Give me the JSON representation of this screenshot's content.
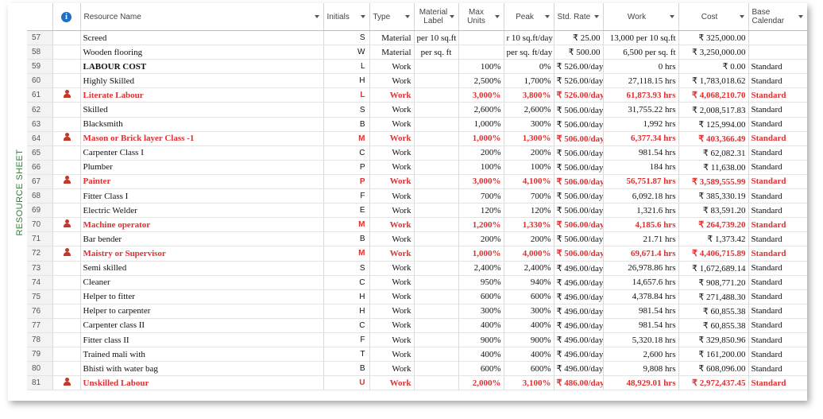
{
  "side_label": "RESOURCE SHEET",
  "columns": {
    "name": "Resource Name",
    "initials": "Initials",
    "type": "Type",
    "material_label": "Material Label",
    "max_units": "Max Units",
    "peak": "Peak",
    "std_rate": "Std. Rate",
    "work": "Work",
    "cost": "Cost",
    "base_calendar": "Base Calendar"
  },
  "rows": [
    {
      "num": "57",
      "name": "Screed",
      "initials": "S",
      "type": "Material",
      "mat": "per 10 sq.ft",
      "max": "",
      "peak": "r 10 sq.ft/day",
      "rate": "₹ 25.00",
      "work": "13,000 per 10 sq.ft",
      "cost": "₹ 325,000.00",
      "cal": "",
      "over": false
    },
    {
      "num": "58",
      "name": "Wooden flooring",
      "initials": "W",
      "type": "Material",
      "mat": "per sq. ft",
      "max": "",
      "peak": "per sq. ft/day",
      "rate": "₹ 500.00",
      "work": "6,500 per sq. ft",
      "cost": "₹ 3,250,000.00",
      "cal": "",
      "over": false
    },
    {
      "num": "59",
      "name": "LABOUR COST",
      "initials": "L",
      "type": "Work",
      "mat": "",
      "max": "100%",
      "peak": "0%",
      "rate": "₹ 526.00/day",
      "work": "0 hrs",
      "cost": "₹ 0.00",
      "cal": "Standard",
      "over": false,
      "bold": true
    },
    {
      "num": "60",
      "name": "Highly Skilled",
      "initials": "H",
      "type": "Work",
      "mat": "",
      "max": "2,500%",
      "peak": "1,700%",
      "rate": "₹ 526.00/day",
      "work": "27,118.15 hrs",
      "cost": "₹ 1,783,018.62",
      "cal": "Standard",
      "over": false
    },
    {
      "num": "61",
      "name": "Literate Labour",
      "initials": "L",
      "type": "Work",
      "mat": "",
      "max": "3,000%",
      "peak": "3,800%",
      "rate": "₹ 526.00/day",
      "work": "61,873.93 hrs",
      "cost": "₹ 4,068,210.70",
      "cal": "Standard",
      "over": true
    },
    {
      "num": "62",
      "name": "Skilled",
      "initials": "S",
      "type": "Work",
      "mat": "",
      "max": "2,600%",
      "peak": "2,600%",
      "rate": "₹ 506.00/day",
      "work": "31,755.22 hrs",
      "cost": "₹ 2,008,517.83",
      "cal": "Standard",
      "over": false
    },
    {
      "num": "63",
      "name": "Blacksmith",
      "initials": "B",
      "type": "Work",
      "mat": "",
      "max": "1,000%",
      "peak": "300%",
      "rate": "₹ 506.00/day",
      "work": "1,992 hrs",
      "cost": "₹ 125,994.00",
      "cal": "Standard",
      "over": false
    },
    {
      "num": "64",
      "name": "Mason or Brick layer Class -1",
      "initials": "M",
      "type": "Work",
      "mat": "",
      "max": "1,000%",
      "peak": "1,300%",
      "rate": "₹ 506.00/day",
      "work": "6,377.34 hrs",
      "cost": "₹ 403,366.49",
      "cal": "Standard",
      "over": true
    },
    {
      "num": "65",
      "name": "Carpenter Class I",
      "initials": "C",
      "type": "Work",
      "mat": "",
      "max": "200%",
      "peak": "200%",
      "rate": "₹ 506.00/day",
      "work": "981.54 hrs",
      "cost": "₹ 62,082.31",
      "cal": "Standard",
      "over": false
    },
    {
      "num": "66",
      "name": "Plumber",
      "initials": "P",
      "type": "Work",
      "mat": "",
      "max": "100%",
      "peak": "100%",
      "rate": "₹ 506.00/day",
      "work": "184 hrs",
      "cost": "₹ 11,638.00",
      "cal": "Standard",
      "over": false
    },
    {
      "num": "67",
      "name": "Painter",
      "initials": "P",
      "type": "Work",
      "mat": "",
      "max": "3,000%",
      "peak": "4,100%",
      "rate": "₹ 506.00/day",
      "work": "56,751.87 hrs",
      "cost": "₹ 3,589,555.99",
      "cal": "Standard",
      "over": true
    },
    {
      "num": "68",
      "name": "Fitter Class I",
      "initials": "F",
      "type": "Work",
      "mat": "",
      "max": "700%",
      "peak": "700%",
      "rate": "₹ 506.00/day",
      "work": "6,092.18 hrs",
      "cost": "₹ 385,330.19",
      "cal": "Standard",
      "over": false
    },
    {
      "num": "69",
      "name": "Electric Welder",
      "initials": "E",
      "type": "Work",
      "mat": "",
      "max": "120%",
      "peak": "120%",
      "rate": "₹ 506.00/day",
      "work": "1,321.6 hrs",
      "cost": "₹ 83,591.20",
      "cal": "Standard",
      "over": false
    },
    {
      "num": "70",
      "name": "Machine operator",
      "initials": "M",
      "type": "Work",
      "mat": "",
      "max": "1,200%",
      "peak": "1,330%",
      "rate": "₹ 506.00/day",
      "work": "4,185.6 hrs",
      "cost": "₹ 264,739.20",
      "cal": "Standard",
      "over": true
    },
    {
      "num": "71",
      "name": "Bar bender",
      "initials": "B",
      "type": "Work",
      "mat": "",
      "max": "200%",
      "peak": "200%",
      "rate": "₹ 506.00/day",
      "work": "21.71 hrs",
      "cost": "₹ 1,373.42",
      "cal": "Standard",
      "over": false
    },
    {
      "num": "72",
      "name": "Maistry or Supervisor",
      "initials": "M",
      "type": "Work",
      "mat": "",
      "max": "1,000%",
      "peak": "4,000%",
      "rate": "₹ 506.00/day",
      "work": "69,671.4 hrs",
      "cost": "₹ 4,406,715.89",
      "cal": "Standard",
      "over": true
    },
    {
      "num": "73",
      "name": "Semi skilled",
      "initials": "S",
      "type": "Work",
      "mat": "",
      "max": "2,400%",
      "peak": "2,400%",
      "rate": "₹ 496.00/day",
      "work": "26,978.86 hrs",
      "cost": "₹ 1,672,689.14",
      "cal": "Standard",
      "over": false
    },
    {
      "num": "74",
      "name": "Cleaner",
      "initials": "C",
      "type": "Work",
      "mat": "",
      "max": "950%",
      "peak": "940%",
      "rate": "₹ 496.00/day",
      "work": "14,657.6 hrs",
      "cost": "₹ 908,771.20",
      "cal": "Standard",
      "over": false
    },
    {
      "num": "75",
      "name": "Helper to fitter",
      "initials": "H",
      "type": "Work",
      "mat": "",
      "max": "600%",
      "peak": "600%",
      "rate": "₹ 496.00/day",
      "work": "4,378.84 hrs",
      "cost": "₹ 271,488.30",
      "cal": "Standard",
      "over": false
    },
    {
      "num": "76",
      "name": "Helper to carpenter",
      "initials": "H",
      "type": "Work",
      "mat": "",
      "max": "300%",
      "peak": "300%",
      "rate": "₹ 496.00/day",
      "work": "981.54 hrs",
      "cost": "₹ 60,855.38",
      "cal": "Standard",
      "over": false
    },
    {
      "num": "77",
      "name": "Carpenter class II",
      "initials": "C",
      "type": "Work",
      "mat": "",
      "max": "400%",
      "peak": "400%",
      "rate": "₹ 496.00/day",
      "work": "981.54 hrs",
      "cost": "₹ 60,855.38",
      "cal": "Standard",
      "over": false
    },
    {
      "num": "78",
      "name": "Fitter class II",
      "initials": "F",
      "type": "Work",
      "mat": "",
      "max": "900%",
      "peak": "900%",
      "rate": "₹ 496.00/day",
      "work": "5,320.18 hrs",
      "cost": "₹ 329,850.96",
      "cal": "Standard",
      "over": false
    },
    {
      "num": "79",
      "name": "Trained mali with",
      "initials": "T",
      "type": "Work",
      "mat": "",
      "max": "400%",
      "peak": "400%",
      "rate": "₹ 496.00/day",
      "work": "2,600 hrs",
      "cost": "₹ 161,200.00",
      "cal": "Standard",
      "over": false
    },
    {
      "num": "80",
      "name": "Bhisti with water bag",
      "initials": "B",
      "type": "Work",
      "mat": "",
      "max": "600%",
      "peak": "600%",
      "rate": "₹ 496.00/day",
      "work": "9,808 hrs",
      "cost": "₹ 608,096.00",
      "cal": "Standard",
      "over": false
    },
    {
      "num": "81",
      "name": "Unskilled Labour",
      "initials": "U",
      "type": "Work",
      "mat": "",
      "max": "2,000%",
      "peak": "3,100%",
      "rate": "₹ 486.00/day",
      "work": "48,929.01 hrs",
      "cost": "₹ 2,972,437.45",
      "cal": "Standard",
      "over": true
    }
  ],
  "colors": {
    "overallocated": "#e03030",
    "side_label": "#2e7d32",
    "info_icon": "#1f6fc5"
  }
}
